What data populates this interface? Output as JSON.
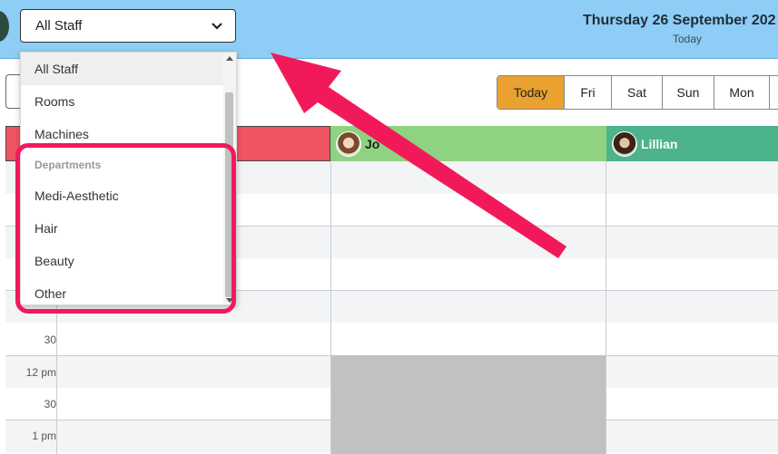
{
  "header": {
    "staff_filter_value": "All Staff",
    "date_title": "Thursday 26 September 202",
    "date_subtitle": "Today"
  },
  "day_tabs": [
    "Today",
    "Fri",
    "Sat",
    "Sun",
    "Mon"
  ],
  "active_day_tab": "Today",
  "columns": [
    {
      "name": "",
      "color": "#ef5461"
    },
    {
      "name": "Jo",
      "color": "#8ed282"
    },
    {
      "name": "Lillian",
      "color": "#4db38a"
    }
  ],
  "time_labels": {
    "row_30": "30",
    "row_12pm": "12 pm",
    "row_30b": "30",
    "row_1pm": "1 pm"
  },
  "dropdown": {
    "items": [
      "All Staff",
      "Rooms",
      "Machines"
    ],
    "group_label": "Departments",
    "departments": [
      "Medi-Aesthetic",
      "Hair",
      "Beauty",
      "Other"
    ]
  },
  "colors": {
    "header_bg": "#8ecdf5",
    "active_tab": "#e9a12f",
    "annotation": "#f2195b"
  },
  "icons": [
    "chevron-down-icon",
    "scroll-up-icon",
    "scroll-down-icon",
    "arrow-annotation"
  ]
}
